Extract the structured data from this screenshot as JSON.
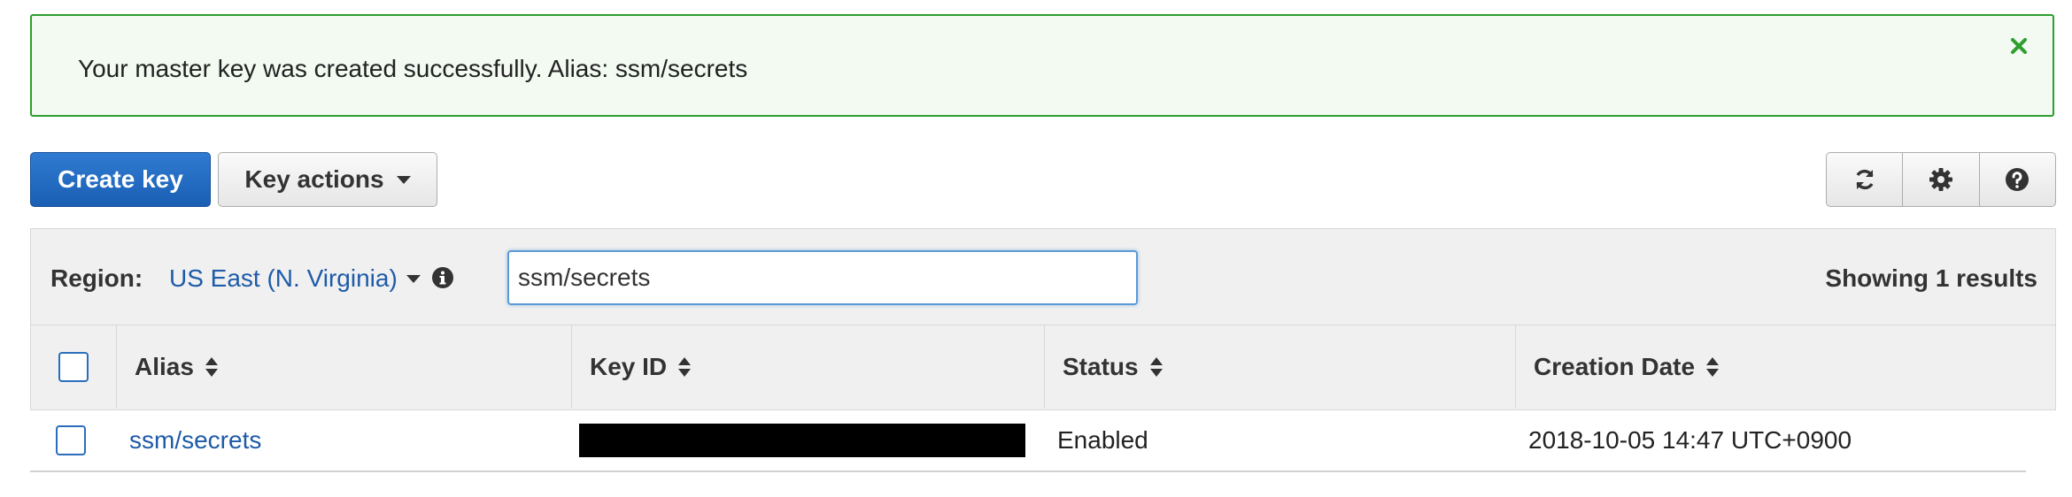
{
  "alert": {
    "message": "Your master key was created successfully. Alias: ssm/secrets",
    "status_color": "#2e9e2e"
  },
  "toolbar": {
    "create_key_label": "Create key",
    "key_actions_label": "Key actions",
    "icons": [
      "refresh-icon",
      "gear-icon",
      "help-icon"
    ]
  },
  "filter": {
    "region_label": "Region:",
    "region_value": "US East (N. Virginia)",
    "search_value": "ssm/secrets",
    "results_text": "Showing 1 results"
  },
  "table": {
    "columns": [
      "Alias",
      "Key ID",
      "Status",
      "Creation Date"
    ],
    "rows": [
      {
        "alias": "ssm/secrets",
        "key_id": "",
        "status": "Enabled",
        "creation_date": "2018-10-05 14:47 UTC+0900"
      }
    ]
  },
  "colors": {
    "primary": "#1a5fb4",
    "link": "#1e5ba8",
    "success_border": "#2e9e2e"
  }
}
